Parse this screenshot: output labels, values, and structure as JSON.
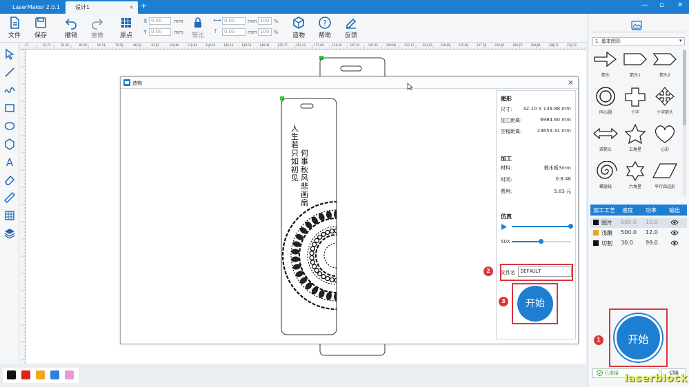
{
  "app": {
    "tabs": [
      {
        "label": "LaserMaker 2.0.1"
      },
      {
        "label": "设计1",
        "close": "×"
      }
    ],
    "new_tab": "+",
    "window_controls": {
      "minimize": "—",
      "restore": "▫",
      "close": "✕"
    }
  },
  "toolbar": {
    "file": "文件",
    "save": "保存",
    "undo": "撤销",
    "redo": "重做",
    "origin": "原点",
    "x_label": "X",
    "y_label": "Y",
    "x_value": "0.00",
    "y_value": "0.00",
    "xy_unit": "mm",
    "lock": "等比",
    "w_value": "0.00",
    "h_value": "0.00",
    "size_unit": "mm",
    "w_pct": "100",
    "h_pct": "100",
    "pct": "%",
    "build": "造物",
    "help": "帮助",
    "feedback": "反馈"
  },
  "ruler": {
    "ticks": [
      "37",
      "62.71",
      "81.28",
      "85.00",
      "59.74",
      "76.59",
      "88.33",
      "92.87",
      "102.80",
      "115.84",
      "119.60",
      "128.14",
      "138.54",
      "148.28",
      "155.77",
      "162.22",
      "175.69",
      "178.40",
      "187.52",
      "195.40",
      "208.08",
      "213.72",
      "223.12",
      "228.60",
      "235.80",
      "247.78",
      "259.60",
      "268.70",
      "280.84",
      "288.72",
      "293.12"
    ]
  },
  "dialog": {
    "title": "造物",
    "close": "×",
    "shape_section": "图形",
    "size_label": "尺寸:",
    "size_value": "32.10 X 139.88 mm",
    "work_dist_label": "加工距离:",
    "work_dist_value": "6984.60 mm",
    "idle_dist_label": "空程距离:",
    "idle_dist_value": "23653.31 mm",
    "process_section": "加工",
    "material_label": "材料:",
    "material_value": "椴木板3mm",
    "time_label": "时间:",
    "time_value": "0:8:46",
    "cost_label": "费用:",
    "cost_value": "5.83 元",
    "sim_section": "仿真",
    "speed_label": "50X",
    "play_progress": 1.0,
    "speed_progress": 0.5,
    "filename_label": "文件名",
    "filename_value": "DEFAULT",
    "start": "开始",
    "preview_text_1": "人生若只如初见",
    "preview_text_2": "何事秋风悲画扇"
  },
  "annotations": {
    "badge1": "1",
    "badge2": "2",
    "badge3": "3"
  },
  "rightpanel": {
    "dropdown": "1. 基本图形",
    "shapes": [
      {
        "label": "箭头",
        "icon": "arrow-icon"
      },
      {
        "label": "箭头1",
        "icon": "arrow1-icon"
      },
      {
        "label": "箭头2",
        "icon": "arrow2-icon"
      },
      {
        "label": "同心圆",
        "icon": "concentric-icon"
      },
      {
        "label": "十字",
        "icon": "cross-icon"
      },
      {
        "label": "十字箭头",
        "icon": "cross-arrow-icon"
      },
      {
        "label": "双箭头",
        "icon": "double-arrow-icon"
      },
      {
        "label": "五角星",
        "icon": "star5-icon"
      },
      {
        "label": "心形",
        "icon": "heart-icon"
      },
      {
        "label": "螺旋线",
        "icon": "spiral-icon"
      },
      {
        "label": "六角星",
        "icon": "star6-icon"
      },
      {
        "label": "平行四边形",
        "icon": "parallelogram-icon"
      }
    ],
    "layers_header": {
      "process": "加工工艺",
      "speed": "速度",
      "power": "功率",
      "output": "输出"
    },
    "layers": [
      {
        "name": "图片",
        "speed": "500.0",
        "power": "10.0",
        "color": "#111111"
      },
      {
        "name": "浅雕",
        "speed": "500.0",
        "power": "12.0",
        "color": "#f1a51c"
      },
      {
        "name": "切割",
        "speed": "30.0",
        "power": "99.0",
        "color": "#111111"
      }
    ],
    "start": "开始",
    "connected": "已连接",
    "switch": "切换"
  },
  "palette": [
    "#111111",
    "#e0221b",
    "#f4a51a",
    "#2d7fe0",
    "#e79ad8"
  ],
  "watermark": "laserblock"
}
